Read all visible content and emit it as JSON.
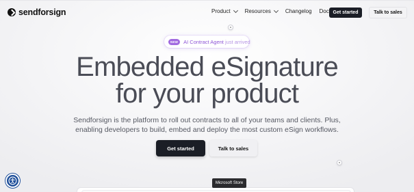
{
  "header": {
    "logo_text": "sendforsign",
    "nav": [
      {
        "label": "Product",
        "has_dropdown": true
      },
      {
        "label": "Resources",
        "has_dropdown": true
      },
      {
        "label": "Changelog",
        "has_dropdown": false
      },
      {
        "label": "Docs",
        "has_dropdown": false
      }
    ],
    "get_started_label": "Get started",
    "talk_to_sales_label": "Talk to sales"
  },
  "announcement": {
    "badge": "NEW",
    "highlight": "AI Contract Agent",
    "rest": "just arrived"
  },
  "hero": {
    "title_line1": "Embedded eSignature",
    "title_line2": "for your product",
    "subtitle_line1": "Sendforsign is the platform to roll out contracts to all of your teams and clients. Plus,",
    "subtitle_line2": "enabling developers to build, embed and deploy the most custom eSign workflows.",
    "primary_cta": "Get started",
    "secondary_cta": "Talk to sales"
  },
  "tooltip": {
    "text": "Microsoft Store"
  },
  "accessibility": {
    "icon": "accessibility-icon"
  },
  "colors": {
    "brand_dark": "#1b1e26",
    "accent_purple": "#a26be0",
    "accessibility_blue": "#1f4f9a"
  }
}
